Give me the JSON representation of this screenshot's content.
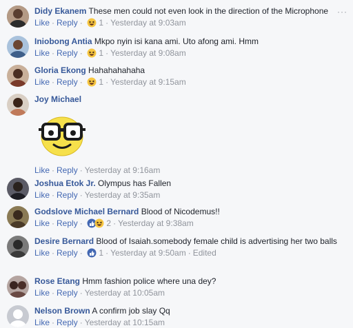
{
  "comments": [
    {
      "author": "Didy Ekanem",
      "text": "These men could not even look in the direction of the Microphone",
      "like": "Like",
      "reply": "Reply",
      "reaction_count": "1",
      "time": "Yesterday at 9:03am",
      "reaction": "haha",
      "avatar_color": "#8b6b55"
    },
    {
      "author": "Iniobong Antia",
      "text": "Mkpo nyin isi kana ami. Uto afong ami. Hmm",
      "like": "Like",
      "reply": "Reply",
      "reaction_count": "1",
      "time": "Yesterday at 9:08am",
      "reaction": "haha",
      "avatar_color": "#5c7fa8"
    },
    {
      "author": "Gloria Ekong",
      "text": "Hahahahahaha",
      "like": "Like",
      "reply": "Reply",
      "reaction_count": "1",
      "time": "Yesterday at 9:15am",
      "reaction": "haha",
      "avatar_color": "#7a4d3a"
    },
    {
      "author": "Joy Michael",
      "text": "",
      "like": "Like",
      "reply": "Reply",
      "time": "Yesterday at 9:16am",
      "sticker": "nerd-emoji-sticker",
      "avatar_color": "#6b4a3a"
    },
    {
      "author": "Joshua Etok Jr.",
      "text": "Olympus has Fallen",
      "like": "Like",
      "reply": "Reply",
      "time": "Yesterday at 9:35am",
      "avatar_color": "#3c3c46"
    },
    {
      "author": "Godslove Michael Bernard",
      "text": "Blood of Nicodemus!!",
      "like": "Like",
      "reply": "Reply",
      "reaction_count": "2",
      "time": "Yesterday at 9:38am",
      "reaction": "like+haha",
      "avatar_color": "#5a4a30"
    },
    {
      "author": "Desire Bernard",
      "text": "Blood of Isaiah.somebody female child is advertising her two balls",
      "like": "Like",
      "reply": "Reply",
      "reaction_count": "1",
      "time": "Yesterday at 9:50am",
      "edited": "Edited",
      "reaction": "like",
      "avatar_color": "#4a4a4a"
    },
    {
      "author": "Rose Etang",
      "text": "Hmm fashion police where una dey?",
      "like": "Like",
      "reply": "Reply",
      "time": "Yesterday at 10:05am",
      "avatar_color": "#6e5a58"
    },
    {
      "author": "Nelson Brown",
      "text": "A confirm job slay Qq",
      "like": "Like",
      "reply": "Reply",
      "time": "Yesterday at 10:15am",
      "avatar_color": "#c7cad1"
    }
  ],
  "menu_label": "···",
  "colors": {
    "link": "#4267b2",
    "author": "#365899",
    "meta": "#90949c",
    "bg": "#f6f7f9",
    "like_blue": "#4267b2",
    "haha_yellow": "#f7c641"
  }
}
